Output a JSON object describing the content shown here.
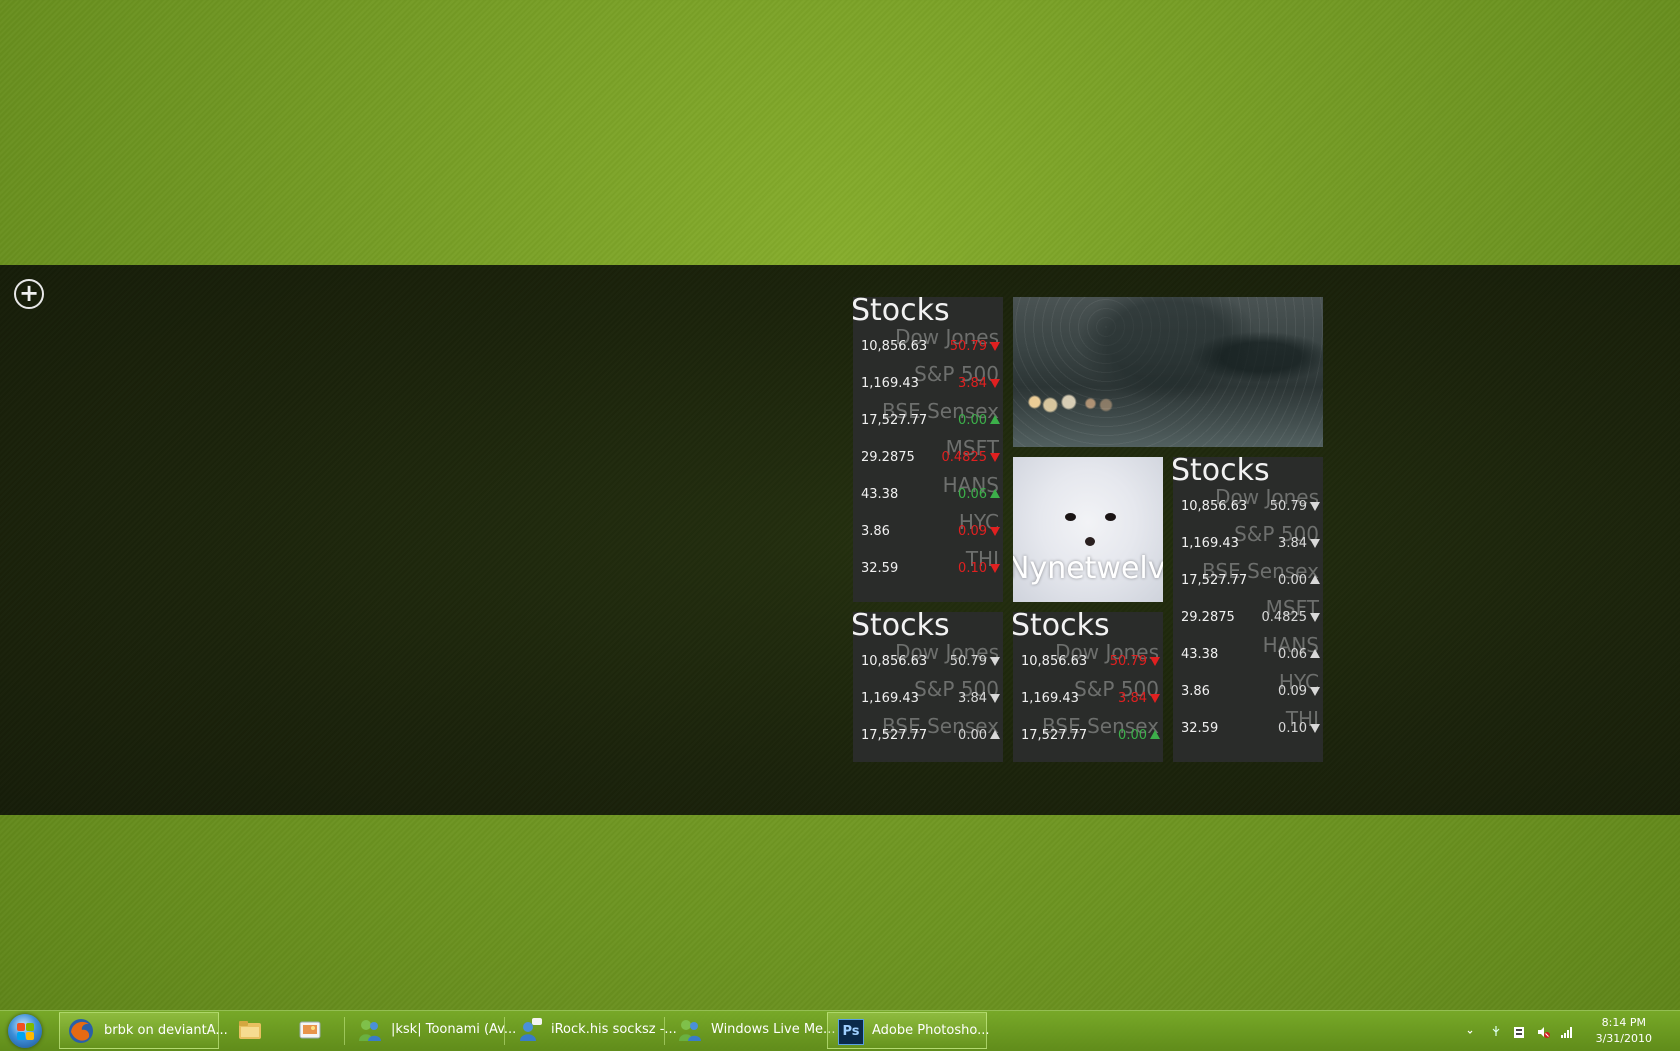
{
  "stocks_tile_1": {
    "title": "Stocks",
    "rows": [
      {
        "name": "Dow Jones",
        "price": "10,856.63",
        "change": "50.79",
        "dir": "down",
        "color": "#e02020"
      },
      {
        "name": "S&P 500",
        "price": "1,169.43",
        "change": "3.84",
        "dir": "down",
        "color": "#e02020"
      },
      {
        "name": "BSE Sensex",
        "price": "17,527.77",
        "change": "0.00",
        "dir": "up",
        "color": "#3cb04a"
      },
      {
        "name": "MSFT",
        "price": "29.2875",
        "change": "0.4825",
        "dir": "down",
        "color": "#e02020"
      },
      {
        "name": "HANS",
        "price": "43.38",
        "change": "0.06",
        "dir": "up",
        "color": "#3cb04a"
      },
      {
        "name": "HYC",
        "price": "3.86",
        "change": "0.09",
        "dir": "down",
        "color": "#e02020"
      },
      {
        "name": "THI",
        "price": "32.59",
        "change": "0.10",
        "dir": "down",
        "color": "#e02020"
      }
    ]
  },
  "stocks_tile_2": {
    "title": "Stocks",
    "rows": [
      {
        "name": "Dow Jones",
        "price": "10,856.63",
        "change": "50.79",
        "dir": "down",
        "color": "#d8d8d8"
      },
      {
        "name": "S&P 500",
        "price": "1,169.43",
        "change": "3.84",
        "dir": "down",
        "color": "#d8d8d8"
      },
      {
        "name": "BSE Sensex",
        "price": "17,527.77",
        "change": "0.00",
        "dir": "up",
        "color": "#d8d8d8"
      },
      {
        "name": "MSFT",
        "price": "29.2875",
        "change": "0.4825",
        "dir": "down",
        "color": "#d8d8d8"
      },
      {
        "name": "HANS",
        "price": "43.38",
        "change": "0.06",
        "dir": "up",
        "color": "#d8d8d8"
      },
      {
        "name": "HYC",
        "price": "3.86",
        "change": "0.09",
        "dir": "down",
        "color": "#d8d8d8"
      },
      {
        "name": "THI",
        "price": "32.59",
        "change": "0.10",
        "dir": "down",
        "color": "#d8d8d8"
      }
    ]
  },
  "stocks_tile_3": {
    "title": "Stocks",
    "rows": [
      {
        "name": "Dow Jones",
        "price": "10,856.63",
        "change": "50.79",
        "dir": "down",
        "color": "#d8d8d8"
      },
      {
        "name": "S&P 500",
        "price": "1,169.43",
        "change": "3.84",
        "dir": "down",
        "color": "#d8d8d8"
      },
      {
        "name": "BSE Sensex",
        "price": "17,527.77",
        "change": "0.00",
        "dir": "up",
        "color": "#d8d8d8"
      }
    ]
  },
  "stocks_tile_4": {
    "title": "Stocks",
    "rows": [
      {
        "name": "Dow Jones",
        "price": "10,856.63",
        "change": "50.79",
        "dir": "down",
        "color": "#e02020"
      },
      {
        "name": "S&P 500",
        "price": "1,169.43",
        "change": "3.84",
        "dir": "down",
        "color": "#e02020"
      },
      {
        "name": "BSE Sensex",
        "price": "17,527.77",
        "change": "0.00",
        "dir": "up",
        "color": "#3cb04a"
      }
    ]
  },
  "photo_tile": {
    "label": "Nynetwelve"
  },
  "taskbar": {
    "buttons": [
      {
        "name": "firefox-taskbar-button",
        "label": "brbk on deviantA...",
        "icon": "firefox-icon"
      },
      {
        "name": "explorer-taskbar-button",
        "label": "",
        "icon": "folder-icon"
      },
      {
        "name": "pictures-taskbar-button",
        "label": "",
        "icon": "pictures-icon"
      },
      {
        "name": "toonami-taskbar-button",
        "label": "|ksk| Toonami (Av...",
        "icon": "messenger-icon"
      },
      {
        "name": "irock-taskbar-button",
        "label": "iRock.his socksz -...",
        "icon": "messenger-chat-icon"
      },
      {
        "name": "wlm-taskbar-button",
        "label": "Windows Live Me...",
        "icon": "messenger-icon"
      },
      {
        "name": "photoshop-taskbar-button",
        "label": "Adobe Photosho...",
        "icon": "photoshop-icon"
      }
    ],
    "photoshop_glyph": "Ps",
    "clock_time": "8:14 PM",
    "clock_date": "3/31/2010"
  }
}
